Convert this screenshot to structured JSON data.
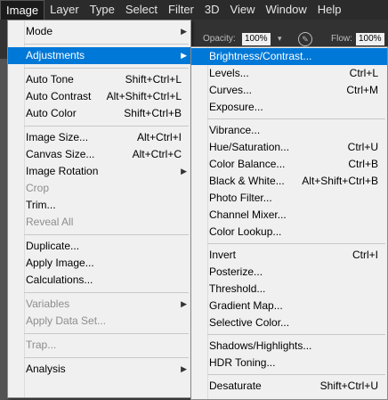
{
  "menubar": {
    "items": [
      "Image",
      "Layer",
      "Type",
      "Select",
      "Filter",
      "3D",
      "View",
      "Window",
      "Help"
    ]
  },
  "options": {
    "opacity_label": "Opacity:",
    "opacity_value": "100%",
    "flow_label": "Flow:",
    "flow_value": "100%"
  },
  "image_menu": {
    "items": [
      {
        "label": "Mode",
        "submenu": true
      },
      {
        "separator": true
      },
      {
        "label": "Adjustments",
        "submenu": true,
        "highlighted": true
      },
      {
        "separator": true
      },
      {
        "label": "Auto Tone",
        "shortcut": "Shift+Ctrl+L"
      },
      {
        "label": "Auto Contrast",
        "shortcut": "Alt+Shift+Ctrl+L"
      },
      {
        "label": "Auto Color",
        "shortcut": "Shift+Ctrl+B"
      },
      {
        "separator": true
      },
      {
        "label": "Image Size...",
        "shortcut": "Alt+Ctrl+I"
      },
      {
        "label": "Canvas Size...",
        "shortcut": "Alt+Ctrl+C"
      },
      {
        "label": "Image Rotation",
        "submenu": true
      },
      {
        "label": "Crop",
        "disabled": true
      },
      {
        "label": "Trim..."
      },
      {
        "label": "Reveal All",
        "disabled": true
      },
      {
        "separator": true
      },
      {
        "label": "Duplicate..."
      },
      {
        "label": "Apply Image..."
      },
      {
        "label": "Calculations..."
      },
      {
        "separator": true
      },
      {
        "label": "Variables",
        "submenu": true,
        "disabled": true
      },
      {
        "label": "Apply Data Set...",
        "disabled": true
      },
      {
        "separator": true
      },
      {
        "label": "Trap...",
        "disabled": true
      },
      {
        "separator": true
      },
      {
        "label": "Analysis",
        "submenu": true
      }
    ]
  },
  "adjustments_menu": {
    "items": [
      {
        "label": "Brightness/Contrast...",
        "highlighted": true
      },
      {
        "label": "Levels...",
        "shortcut": "Ctrl+L"
      },
      {
        "label": "Curves...",
        "shortcut": "Ctrl+M"
      },
      {
        "label": "Exposure..."
      },
      {
        "separator": true
      },
      {
        "label": "Vibrance..."
      },
      {
        "label": "Hue/Saturation...",
        "shortcut": "Ctrl+U"
      },
      {
        "label": "Color Balance...",
        "shortcut": "Ctrl+B"
      },
      {
        "label": "Black & White...",
        "shortcut": "Alt+Shift+Ctrl+B"
      },
      {
        "label": "Photo Filter..."
      },
      {
        "label": "Channel Mixer..."
      },
      {
        "label": "Color Lookup..."
      },
      {
        "separator": true
      },
      {
        "label": "Invert",
        "shortcut": "Ctrl+I"
      },
      {
        "label": "Posterize..."
      },
      {
        "label": "Threshold..."
      },
      {
        "label": "Gradient Map..."
      },
      {
        "label": "Selective Color..."
      },
      {
        "separator": true
      },
      {
        "label": "Shadows/Highlights..."
      },
      {
        "label": "HDR Toning..."
      },
      {
        "separator": true
      },
      {
        "label": "Desaturate",
        "shortcut": "Shift+Ctrl+U"
      }
    ]
  },
  "colors": {
    "highlight": "#0078d7",
    "menu_bg": "#f0f0f0",
    "menubar_bg": "#2b2b2b",
    "disabled_text": "#8d8d8d"
  }
}
